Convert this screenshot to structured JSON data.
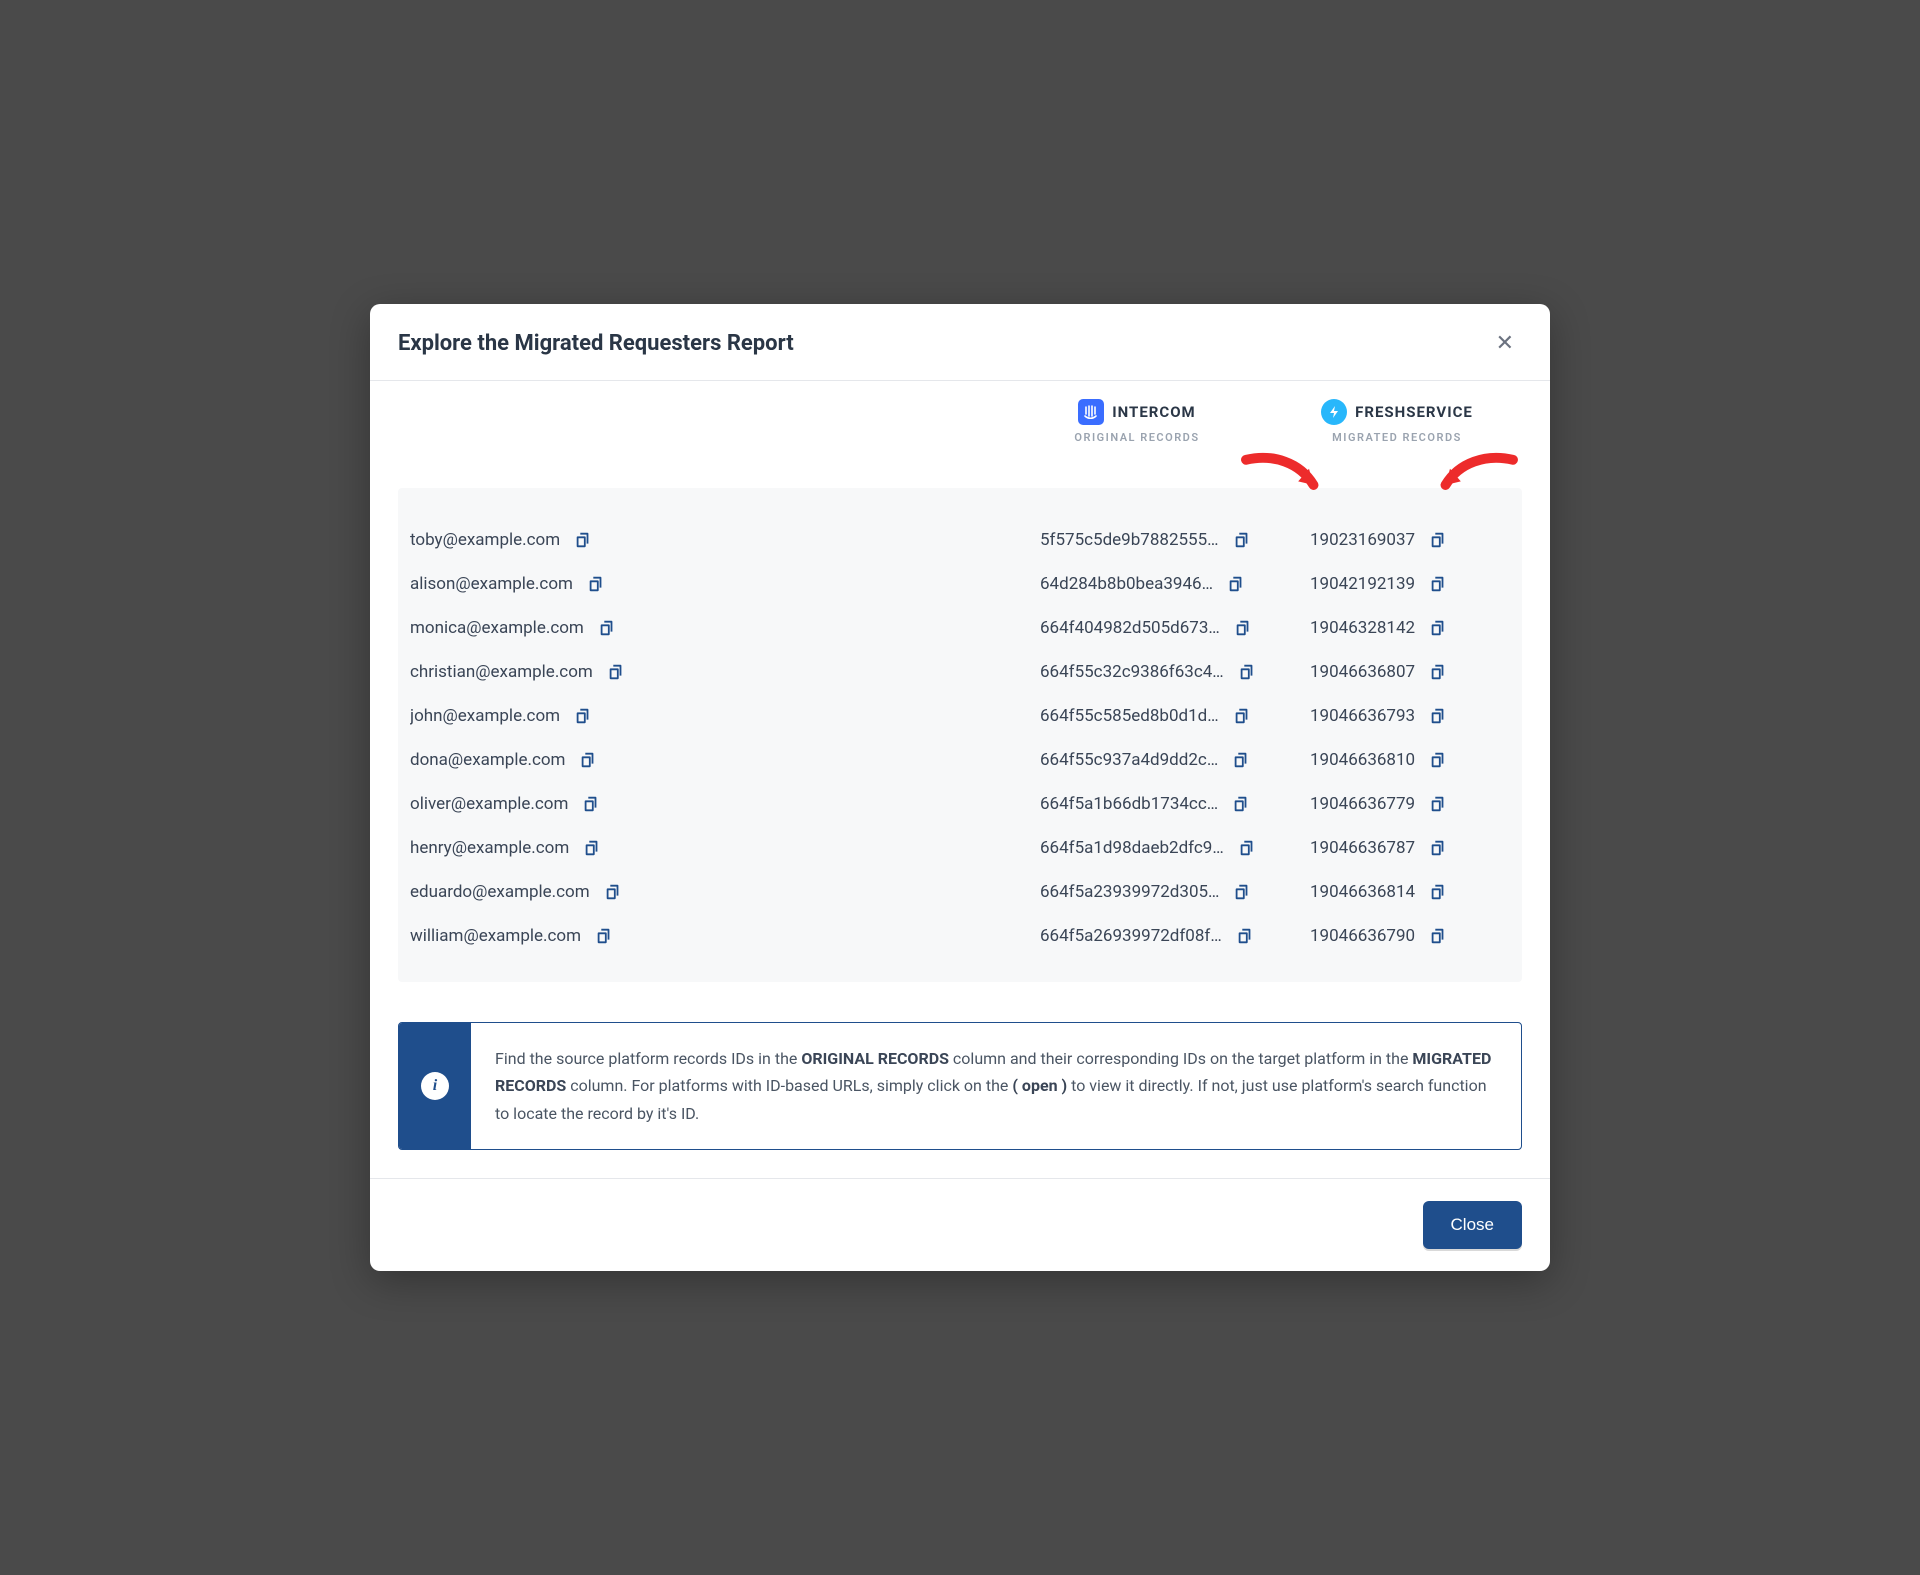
{
  "modal": {
    "title": "Explore the Migrated Requesters Report",
    "close_x": "✕",
    "close_button": "Close"
  },
  "platforms": {
    "source": {
      "name": "INTERCOM",
      "sublabel": "ORIGINAL RECORDS"
    },
    "target": {
      "name": "FRESHSERVICE",
      "sublabel": "MIGRATED RECORDS"
    }
  },
  "records": [
    {
      "email": "toby@example.com",
      "original": "5f575c5de9b7882555…",
      "migrated": "19023169037"
    },
    {
      "email": "alison@example.com",
      "original": "64d284b8b0bea3946…",
      "migrated": "19042192139"
    },
    {
      "email": "monica@example.com",
      "original": "664f404982d505d673…",
      "migrated": "19046328142"
    },
    {
      "email": "christian@example.com",
      "original": "664f55c32c9386f63c4…",
      "migrated": "19046636807"
    },
    {
      "email": "john@example.com",
      "original": "664f55c585ed8b0d1d…",
      "migrated": "19046636793"
    },
    {
      "email": "dona@example.com",
      "original": "664f55c937a4d9dd2c…",
      "migrated": "19046636810"
    },
    {
      "email": "oliver@example.com",
      "original": "664f5a1b66db1734cc…",
      "migrated": "19046636779"
    },
    {
      "email": "henry@example.com",
      "original": "664f5a1d98daeb2dfc9…",
      "migrated": "19046636787"
    },
    {
      "email": "eduardo@example.com",
      "original": "664f5a23939972d305…",
      "migrated": "19046636814"
    },
    {
      "email": "william@example.com",
      "original": "664f5a26939972df08f…",
      "migrated": "19046636790"
    }
  ],
  "info": {
    "text_1": "Find the source platform records IDs in the ",
    "bold_1": "ORIGINAL RECORDS",
    "text_2": " column and their corresponding IDs on the target platform in the ",
    "bold_2": "MIGRATED RECORDS",
    "text_3": " column. For platforms with ID-based URLs, simply click on the ",
    "bold_3": "( open )",
    "text_4": " to view it directly. If not, just use platform's search function to locate the record by it's ID."
  }
}
